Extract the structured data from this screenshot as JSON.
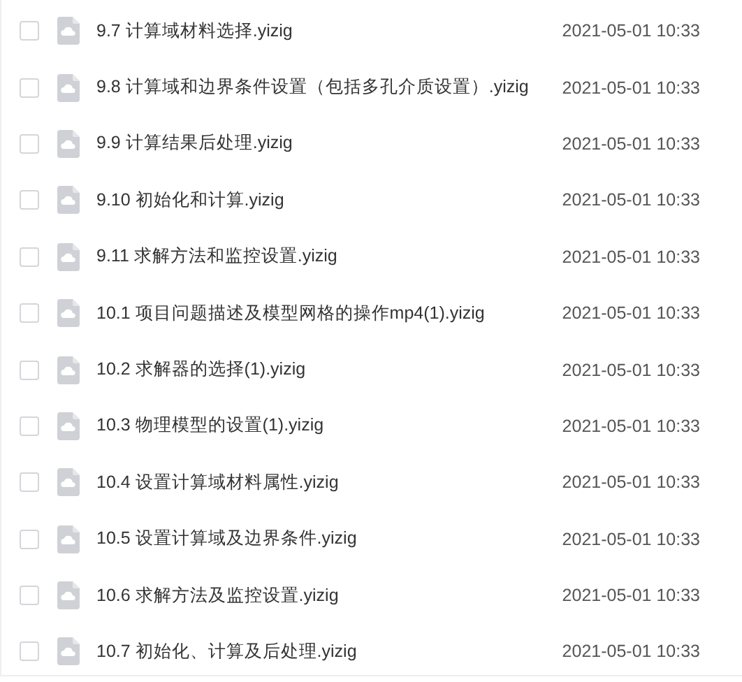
{
  "files": [
    {
      "name": "9.7 计算域材料选择.yizig",
      "modified": "2021-05-01 10:33",
      "checked": false
    },
    {
      "name": "9.8 计算域和边界条件设置（包括多孔介质设置）.yizig",
      "modified": "2021-05-01 10:33",
      "checked": false
    },
    {
      "name": "9.9 计算结果后处理.yizig",
      "modified": "2021-05-01 10:33",
      "checked": false
    },
    {
      "name": "9.10 初始化和计算.yizig",
      "modified": "2021-05-01 10:33",
      "checked": false
    },
    {
      "name": "9.11 求解方法和监控设置.yizig",
      "modified": "2021-05-01 10:33",
      "checked": false
    },
    {
      "name": "10.1 项目问题描述及模型网格的操作mp4(1).yizig",
      "modified": "2021-05-01 10:33",
      "checked": false
    },
    {
      "name": "10.2 求解器的选择(1).yizig",
      "modified": "2021-05-01 10:33",
      "checked": false
    },
    {
      "name": "10.3 物理模型的设置(1).yizig",
      "modified": "2021-05-01 10:33",
      "checked": false
    },
    {
      "name": "10.4 设置计算域材料属性.yizig",
      "modified": "2021-05-01 10:33",
      "checked": false
    },
    {
      "name": "10.5 设置计算域及边界条件.yizig",
      "modified": "2021-05-01 10:33",
      "checked": false
    },
    {
      "name": "10.6 求解方法及监控设置.yizig",
      "modified": "2021-05-01 10:33",
      "checked": false
    },
    {
      "name": "10.7 初始化、计算及后处理.yizig",
      "modified": "2021-05-01 10:33",
      "checked": false
    }
  ]
}
